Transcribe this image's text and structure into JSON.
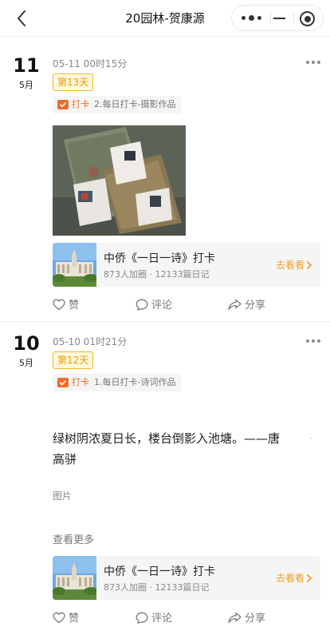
{
  "nav": {
    "title": "20园林-贺康源"
  },
  "entries": [
    {
      "day": "11",
      "month": "5月",
      "timestamp": "05-11 00时15分",
      "badge": "第13天",
      "topic_keyword": "打卡",
      "topic_text": "2.每日打卡-摄影作品",
      "card": {
        "title": "中侨《一日一诗》打卡",
        "meta": "873人加圈 · 12133篇日记",
        "action": "去看看"
      },
      "actions": {
        "like": "赞",
        "comment": "评论",
        "share": "分享"
      }
    },
    {
      "day": "10",
      "month": "5月",
      "timestamp": "05-10 01时21分",
      "badge": "第12天",
      "topic_keyword": "打卡",
      "topic_text": "1.每日打卡-诗词作品",
      "poem_line1": "绿树阴浓夏日长，楼台倒影入池塘。——唐",
      "poem_line2": "高骈",
      "poem_dot": "·",
      "image_placeholder": "图片",
      "view_more": "查看更多",
      "card": {
        "title": "中侨《一日一诗》打卡",
        "meta": "873人加圈 · 12133篇日记",
        "action": "去看看"
      },
      "actions": {
        "like": "赞",
        "comment": "评论",
        "share": "分享"
      }
    }
  ],
  "colors": {
    "accent_orange": "#ef6b2a",
    "badge_yellow": "#f3b52b",
    "link_orange": "#f0a02b"
  }
}
